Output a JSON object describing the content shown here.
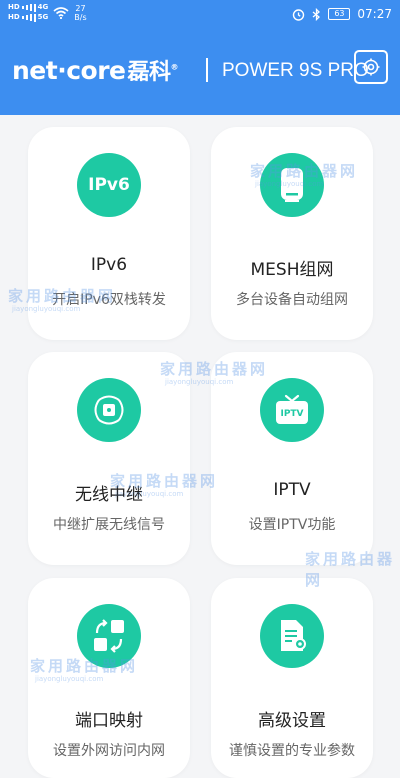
{
  "status_bar": {
    "sim1": "HD",
    "sim2": "HD",
    "net1": "4G",
    "net2": "5G",
    "speed_value": "27",
    "speed_unit": "B/s",
    "battery": "63",
    "time": "07:27"
  },
  "header": {
    "brand": "net·core",
    "brand_cn": "磊科",
    "brand_mark": "®",
    "divider": "|",
    "model": "POWER 9S PRO"
  },
  "cards": [
    {
      "title": "IPv6",
      "subtitle": "开启IPv6双栈转发",
      "icon": "ipv6-icon",
      "icon_text": "IPv6"
    },
    {
      "title": "MESH组网",
      "subtitle": "多台设备自动组网",
      "icon": "router-icon"
    },
    {
      "title": "无线中继",
      "subtitle": "中继扩展无线信号",
      "icon": "wireless-relay-icon"
    },
    {
      "title": "IPTV",
      "subtitle": "设置IPTV功能",
      "icon": "tv-icon",
      "icon_text": "IPTV"
    },
    {
      "title": "端口映射",
      "subtitle": "设置外网访问内网",
      "icon": "port-mapping-icon"
    },
    {
      "title": "高级设置",
      "subtitle": "谨慎设置的专业参数",
      "icon": "advanced-settings-icon"
    }
  ],
  "watermark": "家用路由器网",
  "watermark_url": "jiayongluyouqi.com",
  "colors": {
    "header": "#3d8ef0",
    "accent": "#1ec9a3",
    "background": "#f4f5f7"
  }
}
